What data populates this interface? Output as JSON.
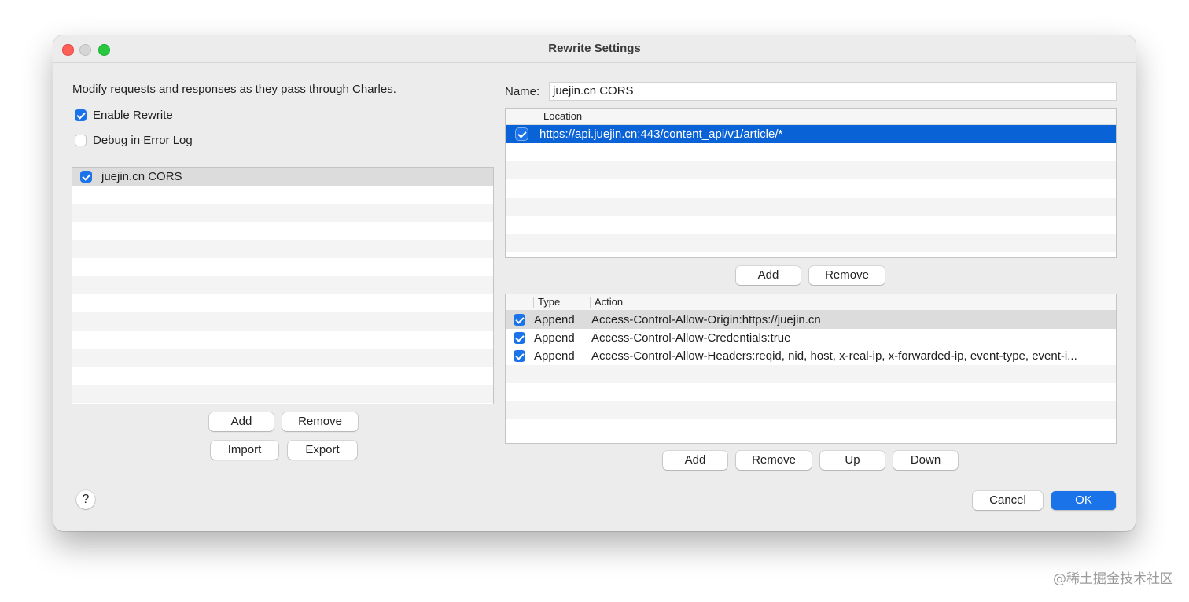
{
  "window": {
    "title": "Rewrite Settings"
  },
  "left": {
    "description": "Modify requests and responses as they pass through Charles.",
    "enable_rewrite": {
      "label": "Enable Rewrite",
      "checked": true
    },
    "debug_error_log": {
      "label": "Debug in Error Log",
      "checked": false
    },
    "sets": [
      {
        "name": "juejin.cn CORS",
        "checked": true
      }
    ],
    "buttons": {
      "add": "Add",
      "remove": "Remove",
      "import": "Import",
      "export": "Export"
    }
  },
  "right": {
    "name_label": "Name:",
    "name_value": "juejin.cn CORS",
    "locations": {
      "header": "Location",
      "rows": [
        {
          "checked": true,
          "location": "https://api.juejin.cn:443/content_api/v1/article/*"
        }
      ],
      "buttons": {
        "add": "Add",
        "remove": "Remove"
      }
    },
    "rules": {
      "headers": {
        "type": "Type",
        "action": "Action"
      },
      "rows": [
        {
          "checked": true,
          "type": "Append",
          "action": "Access-Control-Allow-Origin:https://juejin.cn"
        },
        {
          "checked": true,
          "type": "Append",
          "action": "Access-Control-Allow-Credentials:true"
        },
        {
          "checked": true,
          "type": "Append",
          "action": "Access-Control-Allow-Headers:reqid, nid, host, x-real-ip, x-forwarded-ip, event-type, event-i..."
        }
      ],
      "buttons": {
        "add": "Add",
        "remove": "Remove",
        "up": "Up",
        "down": "Down"
      }
    }
  },
  "footer": {
    "help": "?",
    "cancel": "Cancel",
    "ok": "OK"
  },
  "watermark": "@稀土掘金技术社区",
  "colors": {
    "accent": "#1a73e8",
    "selected_row": "#0a63d6"
  }
}
